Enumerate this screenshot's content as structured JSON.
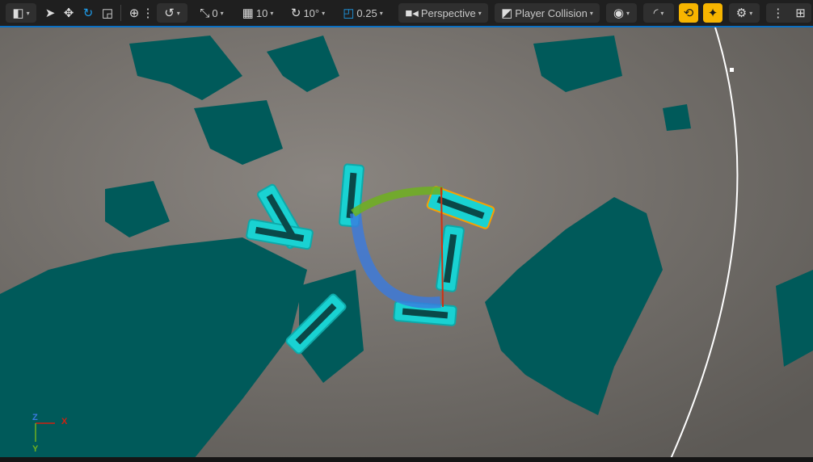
{
  "toolbar": {
    "select_mode_icon": "select-mode-icon",
    "transform_tools": [
      "select-arrow-icon",
      "translate-icon",
      "rotate-icon",
      "scale-icon"
    ],
    "active_tool": "rotate",
    "coordinate_space_icon": "globe-icon",
    "surface_snap_icon": "surface-snap-icon",
    "translate_snap": "0",
    "grid_snap": "10",
    "rotation_snap": "10°",
    "scale_snap": "0.25",
    "view_mode": "Perspective",
    "view_lit_mode": "Player Collision",
    "show_icon": "eye-icon",
    "realtime_icon": "speed-icon",
    "game_view_icon": "game-view-icon",
    "immersive_icon": "sparkle-icon",
    "settings_icon": "gear-icon",
    "layout_icon": "viewport-layout-icon"
  },
  "colors": {
    "accent": "#1e9be8",
    "active_yellow": "#f7b500",
    "selection": "#f7a000",
    "collision_teal": "#005a5a",
    "mesh_cyan": "#19d2d2"
  },
  "axis_gizmo": {
    "x": "X",
    "y": "Y",
    "z": "Z"
  }
}
